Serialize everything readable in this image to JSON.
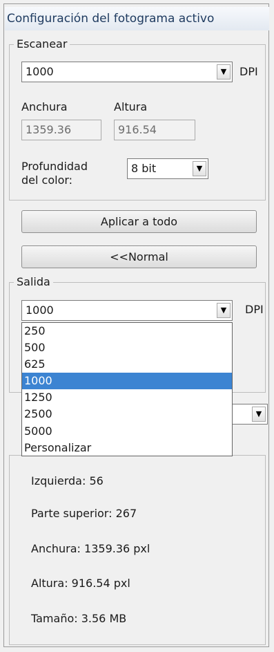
{
  "panel": {
    "title": "Configuración del fotograma activo"
  },
  "scan": {
    "group_label": "Escanear",
    "dpi_value": "1000",
    "dpi_unit": "DPI",
    "width_label": "Anchura",
    "height_label": "Altura",
    "width_value": "1359.36",
    "height_value": "916.54",
    "depth_label_line1": "Profundidad",
    "depth_label_line2": "del color:",
    "depth_value": "8 bit"
  },
  "buttons": {
    "apply_all": "Aplicar a todo",
    "normal": "<<Normal"
  },
  "output": {
    "group_label": "Salida",
    "dpi_value": "1000",
    "dpi_unit": "DPI",
    "dpi_options": [
      "250",
      "500",
      "625",
      "1000",
      "1250",
      "2500",
      "5000",
      "Personalizar"
    ],
    "selected_option": "1000"
  },
  "info": {
    "left": "Izquierda: 56",
    "top": "Parte superior: 267",
    "width": "Anchura: 1359.36 pxl",
    "height": "Altura: 916.54 pxl",
    "size": "Tamaño: 3.56 MB"
  }
}
